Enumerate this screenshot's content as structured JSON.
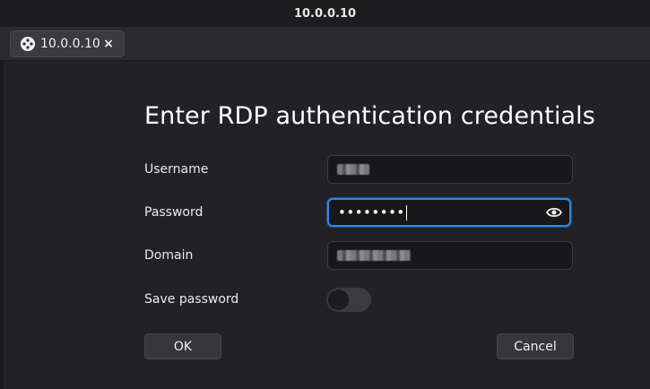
{
  "window": {
    "title": "10.0.0.10"
  },
  "tab": {
    "label": "10.0.0.10",
    "close_glyph": "×",
    "icon": "rdp-connection-icon"
  },
  "dialog": {
    "heading": "Enter RDP authentication credentials",
    "username": {
      "label": "Username",
      "value_redacted": true
    },
    "password": {
      "label": "Password",
      "masked_value": "••••••••",
      "reveal_icon": "eye-icon"
    },
    "domain": {
      "label": "Domain",
      "value_redacted": true
    },
    "save_password": {
      "label": "Save password",
      "enabled": false
    },
    "ok_label": "OK",
    "cancel_label": "Cancel"
  },
  "colors": {
    "accent": "#3584e4",
    "background": "#222226",
    "field": "#18181b"
  }
}
